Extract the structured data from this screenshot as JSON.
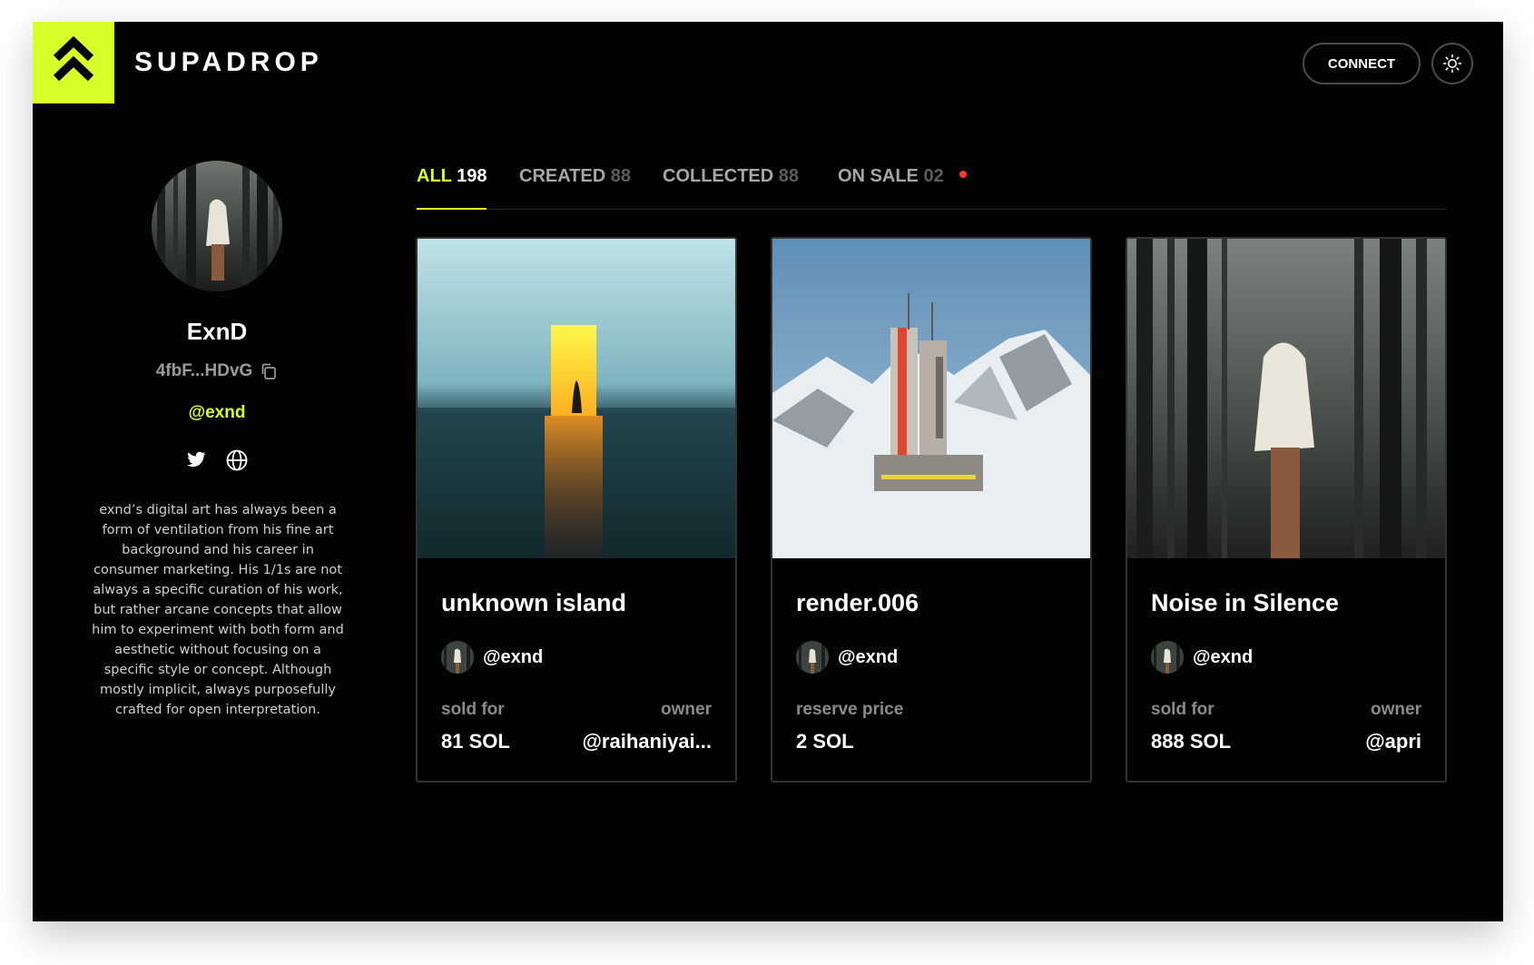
{
  "brand": {
    "name": "SUPADROP",
    "accent": "#d9ff2b"
  },
  "header": {
    "connect_label": "CONNECT",
    "theme_icon": "sun-icon"
  },
  "profile": {
    "name": "ExnD",
    "wallet": "4fbF...HDvG",
    "handle": "@exnd",
    "socials": [
      "twitter-icon",
      "globe-icon"
    ],
    "bio": "exnd’s digital art has always been a form of ventilation from his fine art background and his career in consumer marketing. His 1/1s are not always a specific curation of his work, but rather arcane concepts that allow him to experiment with both form and aesthetic without focusing on a specific style or concept. Although mostly implicit, always purposefully crafted for open interpretation."
  },
  "tabs": [
    {
      "label": "ALL",
      "count": "198",
      "active": true
    },
    {
      "label": "CREATED",
      "count": "88"
    },
    {
      "label": "COLLECTED",
      "count": "88"
    },
    {
      "label": "ON SALE",
      "count": "02",
      "indicator": "#ff3b30"
    }
  ],
  "cards": [
    {
      "title": "unknown island",
      "creator": "@exnd",
      "left_label": "sold for",
      "left_value": "81 SOL",
      "right_label": "owner",
      "right_value": "@raihaniyai..."
    },
    {
      "title": "render.006",
      "creator": "@exnd",
      "left_label": "reserve price",
      "left_value": "2 SOL",
      "right_label": "",
      "right_value": ""
    },
    {
      "title": "Noise in Silence",
      "creator": "@exnd",
      "left_label": "sold for",
      "left_value": "888 SOL",
      "right_label": "owner",
      "right_value": "@apri"
    }
  ]
}
